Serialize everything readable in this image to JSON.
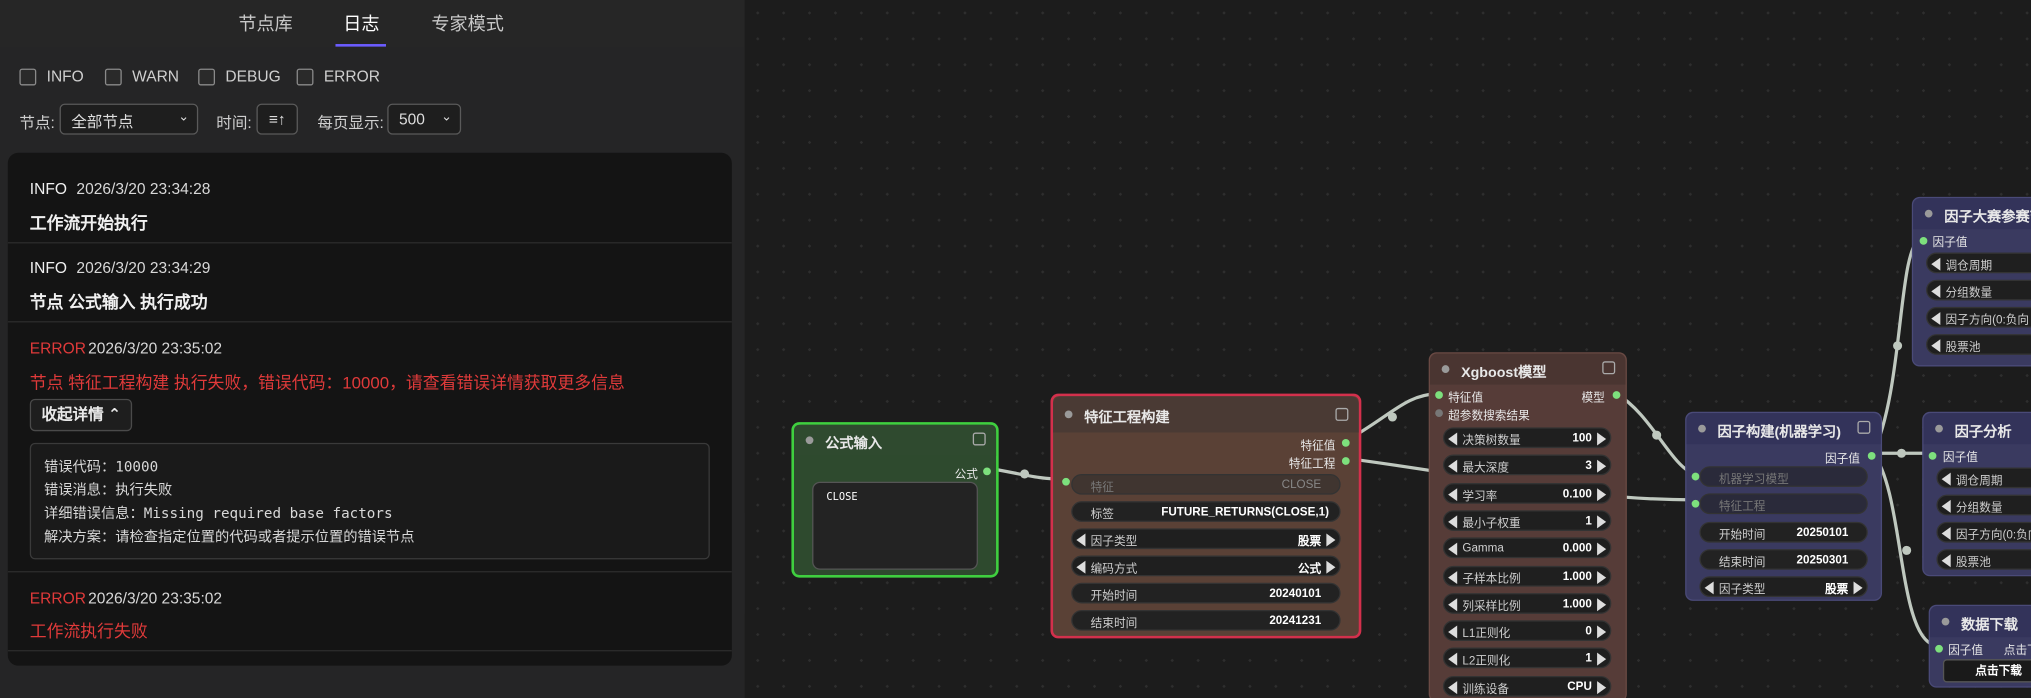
{
  "tabs": [
    "节点库",
    "日志",
    "专家模式"
  ],
  "filters": {
    "levels": [
      "INFO",
      "WARN",
      "DEBUG",
      "ERROR"
    ],
    "node_label": "节点:",
    "node_value": "全部节点",
    "time_label": "时间:",
    "page_size_label": "每页显示:",
    "page_size_value": "500"
  },
  "logs": [
    {
      "level": "INFO",
      "time": "2026/3/20 23:34:28",
      "message": "工作流开始执行"
    },
    {
      "level": "INFO",
      "time": "2026/3/20 23:34:29",
      "message": "节点 公式输入 执行成功"
    },
    {
      "level": "ERROR",
      "time": "2026/3/20 23:35:02",
      "message": "节点 特征工程构建 执行失败，错误代码：10000，请查看错误详情获取更多信息",
      "collapse_label": "收起详情",
      "details": [
        "错误代码：10000",
        "错误消息：执行失败",
        "详细错误信息：Missing required base factors",
        "解决方案：请检查指定位置的代码或者提示位置的错误节点"
      ]
    },
    {
      "level": "ERROR",
      "time": "2026/3/20 23:35:02",
      "message": "工作流执行失败"
    }
  ],
  "colors": {
    "accent": "#6b5cff",
    "error": "#e03a3a",
    "port": "#7de07d"
  },
  "nodes": {
    "formula": {
      "title": "公式输入",
      "output": "公式",
      "code": "close"
    },
    "feature": {
      "title": "特征工程构建",
      "outputs": [
        "特征值",
        "特征工程"
      ],
      "input": "特征",
      "widgets": [
        {
          "label": "特征",
          "value": "CLOSE"
        },
        {
          "label": "标签",
          "value": "FUTURE_RETURNS(CLOSE,1)"
        },
        {
          "label": "因子类型",
          "value": "股票"
        },
        {
          "label": "编码方式",
          "value": "公式"
        },
        {
          "label": "开始时间",
          "value": "20240101"
        },
        {
          "label": "结束时间",
          "value": "20241231"
        }
      ]
    },
    "xgb": {
      "title": "Xgboost模型",
      "inputs": [
        "特征值",
        "超参数搜索结果"
      ],
      "output": "模型",
      "widgets": [
        {
          "label": "决策树数量",
          "value": "100"
        },
        {
          "label": "最大深度",
          "value": "3"
        },
        {
          "label": "学习率",
          "value": "0.100"
        },
        {
          "label": "最小子权重",
          "value": "1"
        },
        {
          "label": "Gamma",
          "value": "0.000"
        },
        {
          "label": "子样本比例",
          "value": "1.000"
        },
        {
          "label": "列采样比例",
          "value": "1.000"
        },
        {
          "label": "L1正则化",
          "value": "0"
        },
        {
          "label": "L2正则化",
          "value": "1"
        },
        {
          "label": "训练设备",
          "value": "CPU"
        }
      ]
    },
    "factor": {
      "title": "因子构建(机器学习)",
      "output": "因子值",
      "inputs": [
        "机器学习模型",
        "特征工程"
      ],
      "widgets": [
        {
          "label": "开始时间",
          "value": "20250101"
        },
        {
          "label": "结束时间",
          "value": "20250301"
        },
        {
          "label": "因子类型",
          "value": "股票"
        }
      ]
    },
    "contest": {
      "title": "因子大赛参赛节",
      "input": "因子值",
      "widgets": [
        "调仓周期",
        "分组数量",
        "因子方向(0:负向",
        "股票池"
      ]
    },
    "analysis": {
      "title": "因子分析",
      "input": "因子值",
      "widgets": [
        "调仓周期",
        "分组数量",
        "因子方向(0:负向",
        "股票池"
      ]
    },
    "download": {
      "title": "数据下载",
      "input": "因子值",
      "hint": "点击下",
      "button": "点击下载"
    }
  }
}
